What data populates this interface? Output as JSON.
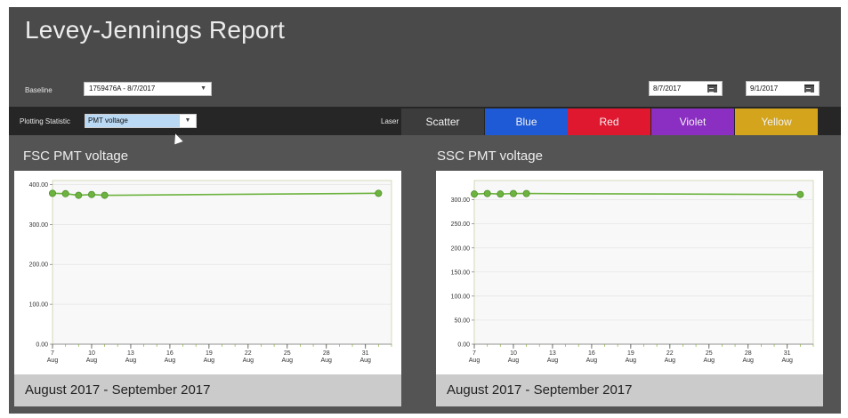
{
  "header": {
    "title": "Levey-Jennings Report",
    "baseline_label": "Baseline",
    "baseline_value": "1759476A - 8/7/2017",
    "start_date": "8/7/2017",
    "end_date": "9/1/2017"
  },
  "toolbar": {
    "plotting_statistic_label": "Plotting Statistic",
    "plotting_statistic_value": "PMT voltage",
    "laser_label": "Laser",
    "lasers": [
      {
        "label": "Scatter",
        "color": "#3c3c3c"
      },
      {
        "label": "Blue",
        "color": "#1e5ad6"
      },
      {
        "label": "Red",
        "color": "#e0182f"
      },
      {
        "label": "Violet",
        "color": "#8a2fc2"
      },
      {
        "label": "Yellow",
        "color": "#d3a41c"
      }
    ]
  },
  "panels": [
    {
      "title": "FSC PMT voltage",
      "footer": "August 2017 - September 2017"
    },
    {
      "title": "SSC PMT voltage",
      "footer": "August 2017 - September 2017"
    }
  ],
  "chart_data": [
    {
      "type": "line",
      "title": "FSC PMT voltage",
      "x": [
        "Aug 7",
        "Aug 8",
        "Aug 9",
        "Aug 10",
        "Aug 11",
        "Sep 1"
      ],
      "values": [
        378,
        377,
        373,
        375,
        373,
        378
      ],
      "ylim": [
        0,
        410
      ],
      "yticks": [
        "0.00",
        "100.00",
        "200.00",
        "300.00",
        "400.00"
      ],
      "xtick_days": [
        "7",
        "10",
        "13",
        "16",
        "19",
        "22",
        "25",
        "28",
        "31"
      ],
      "xtick_month": "Aug",
      "color": "#6db33f"
    },
    {
      "type": "line",
      "title": "SSC PMT voltage",
      "x": [
        "Aug 7",
        "Aug 8",
        "Aug 9",
        "Aug 10",
        "Aug 11",
        "Sep 1"
      ],
      "values": [
        312,
        313,
        312,
        313,
        313,
        311
      ],
      "ylim": [
        0,
        340
      ],
      "yticks": [
        "0.00",
        "50.00",
        "100.00",
        "150.00",
        "200.00",
        "250.00",
        "300.00"
      ],
      "xtick_days": [
        "7",
        "10",
        "13",
        "16",
        "19",
        "22",
        "25",
        "28",
        "31"
      ],
      "xtick_month": "Aug",
      "color": "#6db33f"
    }
  ]
}
